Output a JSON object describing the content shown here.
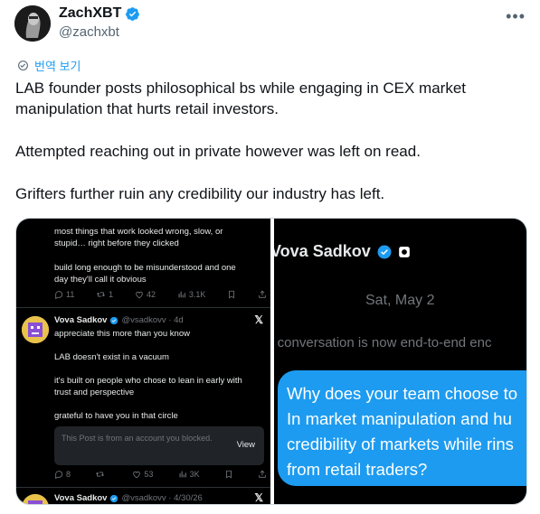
{
  "tweet": {
    "author_name": "ZachXBT",
    "author_handle": "@zachxbt",
    "more_label": "•••",
    "translate_label": "번역 보기",
    "paragraphs": [
      "LAB founder posts philosophical bs while engaging in CEX market manipulation that hurts retail investors.",
      "Attempted reaching out in private however was left on read.",
      "Grifters further ruin any credibility our industry has left."
    ]
  },
  "media_left": {
    "top_post": {
      "lines": [
        "most things that work looked wrong, slow, or",
        "stupid… right before they clicked",
        "build long enough to be misunderstood and one",
        "day they'll call it obvious"
      ],
      "replies": "11",
      "reposts": "1",
      "likes": "42",
      "views": "3.1K"
    },
    "reply_post": {
      "name": "Vova Sadkov",
      "meta": "@vsadkovv · 4d",
      "lines": [
        "appreciate this more than you know",
        "LAB doesn't exist in a vacuum",
        "it's built on people who chose to lean in early with",
        "trust and perspective",
        "grateful to have you in that circle"
      ],
      "blocked_text": "This Post is from an account you blocked.",
      "view_label": "View",
      "replies": "8",
      "reposts": "",
      "likes": "53",
      "views": "3K"
    },
    "bottom_post": {
      "name": "Vova Sadkov",
      "meta": "@vsadkovv · 4/30/26"
    }
  },
  "media_right": {
    "name": "Vova Sadkov",
    "date": "Sat, May 2",
    "system_text": "s conversation is now end-to-end enc",
    "bubble_lines": [
      "Why does your team choose to",
      "In market manipulation and hu",
      "credibility of markets while rins",
      "from retail traders?"
    ]
  },
  "colors": {
    "accent": "#1d9bf0",
    "text": "#0f1419",
    "secondary": "#536471",
    "dark_bg": "#000000"
  }
}
